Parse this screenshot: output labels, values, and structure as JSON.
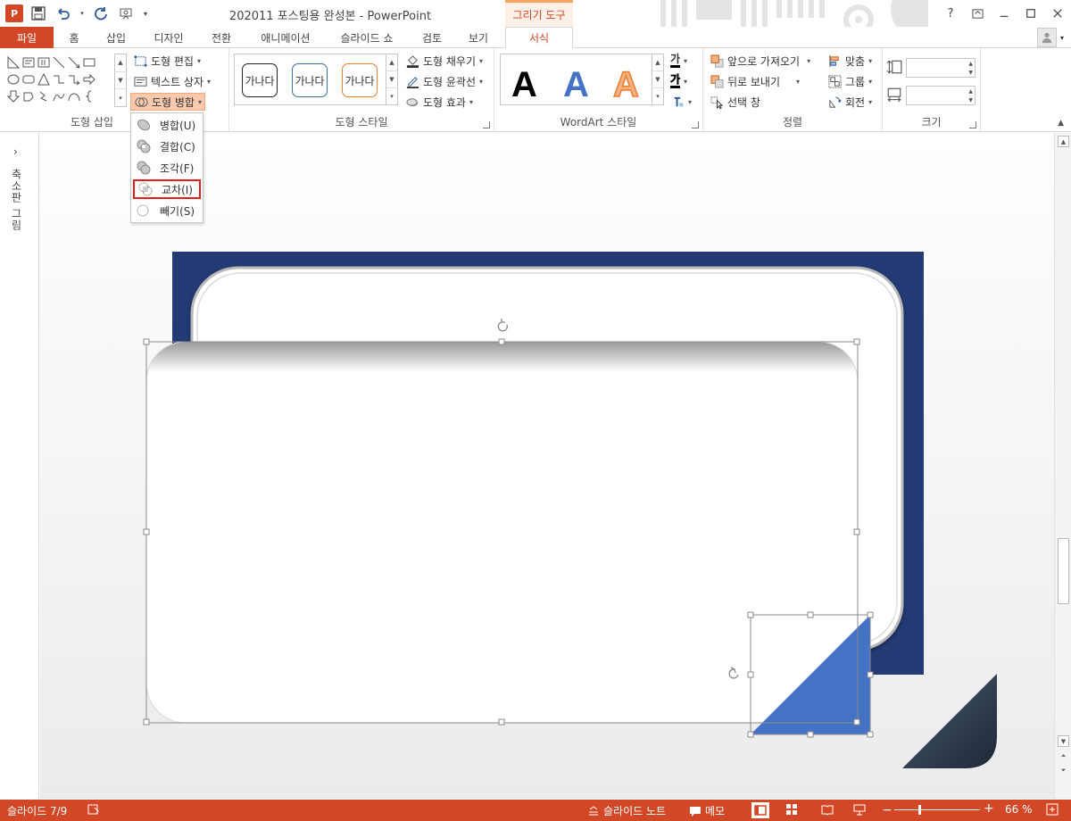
{
  "window": {
    "title": "202011 포스팅용 완성본 - PowerPoint",
    "app_logo": "P",
    "contextual_tab_group": "그리기 도구",
    "help": "?"
  },
  "tabs": [
    {
      "label": "파일"
    },
    {
      "label": "홈"
    },
    {
      "label": "삽입"
    },
    {
      "label": "디자인"
    },
    {
      "label": "전환"
    },
    {
      "label": "애니메이션"
    },
    {
      "label": "슬라이드 쇼"
    },
    {
      "label": "검토"
    },
    {
      "label": "보기"
    },
    {
      "label": "서식"
    }
  ],
  "ribbon": {
    "insert_shapes": {
      "label": "도형 삽입",
      "edit_shape": "도형 편집",
      "text_box": "텍스트 상자",
      "merge_shapes": "도형 병합"
    },
    "shape_styles": {
      "label": "도형 스타일",
      "swatch_text": "가나다",
      "fill": "도형 채우기",
      "outline": "도형 윤곽선",
      "effects": "도형 효과"
    },
    "wordart": {
      "label": "WordArt 스타일",
      "letter": "A",
      "text_fill_glyph": "가",
      "text_outline_glyph": "가"
    },
    "arrange": {
      "label": "정렬",
      "bring_forward": "앞으로 가져오기",
      "send_backward": "뒤로 보내기",
      "selection_pane": "선택 창",
      "align": "맞춤",
      "group": "그룹",
      "rotate": "회전"
    },
    "size": {
      "label": "크기",
      "height": "",
      "width": ""
    }
  },
  "merge_menu": {
    "items": [
      {
        "label": "병합(U)"
      },
      {
        "label": "결합(C)"
      },
      {
        "label": "조각(F)"
      },
      {
        "label": "교차(I)"
      },
      {
        "label": "빼기(S)"
      }
    ],
    "highlighted_index": 3
  },
  "left_panel": {
    "chevron": "›",
    "label": "축소판 그림"
  },
  "statusbar": {
    "slide_indicator": "슬라이드 7/9",
    "notes": "슬라이드 노트",
    "comments": "메모",
    "zoom_out": "−",
    "zoom_in": "+",
    "zoom_level": "66 %"
  },
  "colors": {
    "accent": "#d24726",
    "slide_frame": "#233a74",
    "triangle_fill": "#4472c4",
    "corner_dark": "#2c3a4f"
  }
}
